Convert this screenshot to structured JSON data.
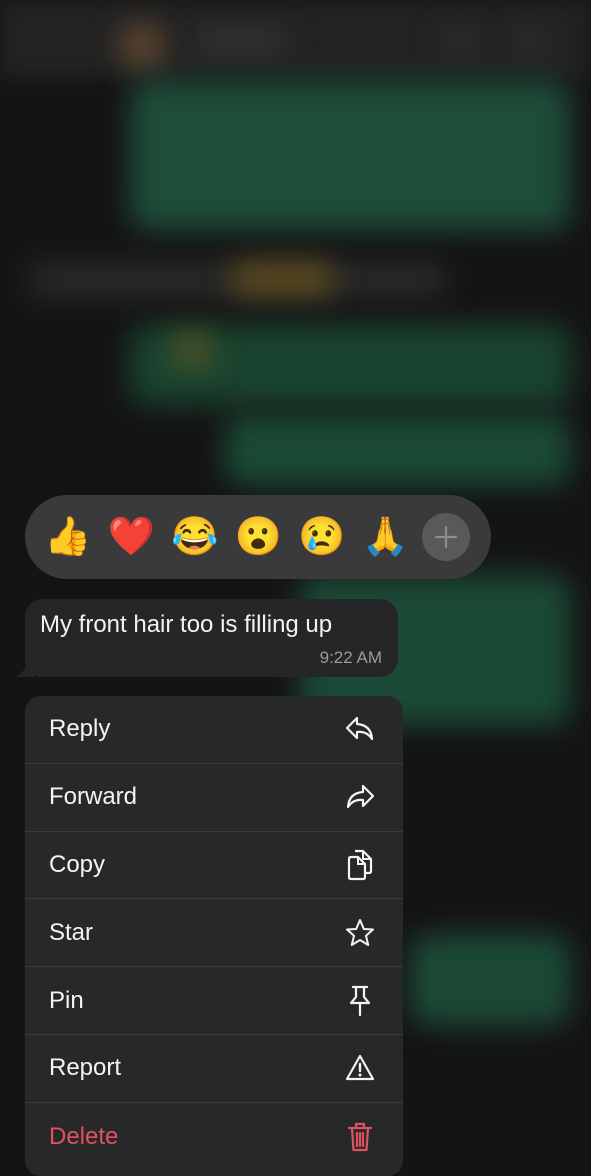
{
  "reactions": {
    "emojis": [
      {
        "name": "thumbs-up",
        "glyph": "👍"
      },
      {
        "name": "red-heart",
        "glyph": "❤️"
      },
      {
        "name": "tears-of-joy",
        "glyph": "😂"
      },
      {
        "name": "surprised-face",
        "glyph": "😮"
      },
      {
        "name": "crying-face",
        "glyph": "😢"
      },
      {
        "name": "folded-hands",
        "glyph": "🙏"
      }
    ],
    "more_icon": "plus-icon"
  },
  "message": {
    "text": "My front hair too is filling up",
    "time": "9:22 AM"
  },
  "menu": {
    "items": [
      {
        "label": "Reply",
        "icon": "reply-icon"
      },
      {
        "label": "Forward",
        "icon": "forward-icon"
      },
      {
        "label": "Copy",
        "icon": "copy-icon"
      },
      {
        "label": "Star",
        "icon": "star-icon"
      },
      {
        "label": "Pin",
        "icon": "pin-icon"
      },
      {
        "label": "Report",
        "icon": "warning-icon"
      },
      {
        "label": "Delete",
        "icon": "trash-icon",
        "destructive": true
      }
    ]
  },
  "colors": {
    "destructive": "#e0525f",
    "menu_bg": "#272828",
    "bubble_bg": "#262628",
    "reaction_bar_bg": "#3a3a3c"
  }
}
